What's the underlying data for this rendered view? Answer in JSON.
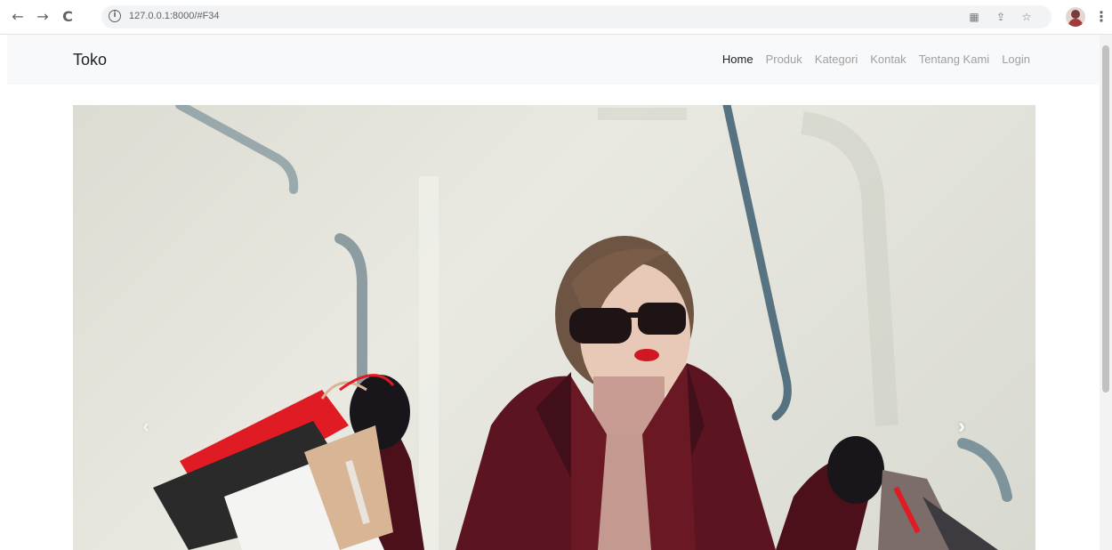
{
  "browser": {
    "url": "127.0.0.1:8000/#F34",
    "back_icon": "←",
    "forward_icon": "→",
    "reload_icon": "C"
  },
  "navbar": {
    "brand": "Toko",
    "items": [
      {
        "label": "Home",
        "active": true
      },
      {
        "label": "Produk",
        "active": false
      },
      {
        "label": "Kategori",
        "active": false
      },
      {
        "label": "Kontak",
        "active": false
      },
      {
        "label": "Tentang Kami",
        "active": false
      },
      {
        "label": "Login",
        "active": false
      }
    ]
  },
  "carousel": {
    "prev_glyph": "‹",
    "next_glyph": "›"
  },
  "colors": {
    "navbar_bg": "#f8f9fa",
    "coat": "#5c1420",
    "bag_red": "#e01b24"
  }
}
